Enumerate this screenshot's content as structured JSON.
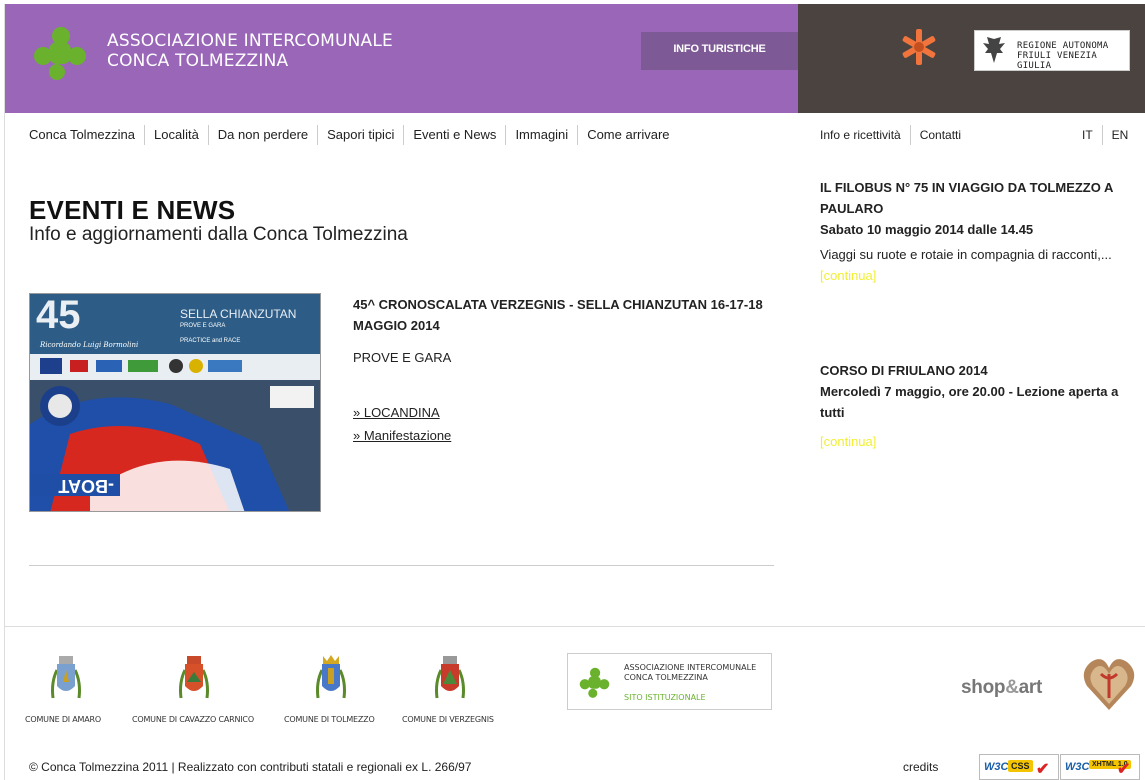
{
  "header": {
    "logo_line1": "ASSOCIAZIONE INTERCOMUNALE",
    "logo_line2": "CONCA TOLMEZZINA",
    "info_button": "INFO TURISTICHE",
    "region_line1": "REGIONE AUTONOMA",
    "region_line2": "FRIULI VENEZIA GIULIA",
    "colors": {
      "purple": "#9966b8",
      "dark": "#4a4340",
      "green": "#6ab22d",
      "orange": "#f0743c"
    }
  },
  "nav": {
    "items": [
      "Conca Tolmezzina",
      "Località",
      "Da non perdere",
      "Sapori tipici",
      "Eventi e News",
      "Immagini",
      "Come arrivare"
    ],
    "right": [
      "Info e ricettività",
      "Contatti"
    ],
    "languages": [
      "IT",
      "EN"
    ]
  },
  "main": {
    "title": "EVENTI E NEWS",
    "subtitle": "Info e aggiornamenti dalla Conca Tolmezzina",
    "event": {
      "title": "45^ CRONOSCALATA VERZEGNIS - SELLA CHIANZUTAN 16-17-18 MAGGIO 2014",
      "desc": "PROVE E GARA",
      "links": [
        "» LOCANDINA",
        "» Manifestazione"
      ],
      "image_text": {
        "big_number": "45",
        "heading": "SELLA CHIANZUTAN",
        "row1": "PROVE E GARA",
        "row2": "PRACTICE and RACE",
        "subtitle": "Ricordando Luigi Bormolini",
        "banner": "-BOAT"
      }
    }
  },
  "sidebar": {
    "news": [
      {
        "title": "IL FILOBUS N° 75 IN VIAGGIO DA TOLMEZZO A PAULARO",
        "date": "Sabato 10 maggio 2014 dalle 14.45",
        "text": "Viaggi su ruote e rotaie in compagnia di racconti,...",
        "more": "[continua]"
      },
      {
        "title": "CORSO DI FRIULANO 2014",
        "date": "Mercoledì 7 maggio, ore 20.00 - Lezione aperta a tutti",
        "text": "",
        "more": "[continua]"
      }
    ]
  },
  "footer": {
    "comuni": [
      "COMUNE DI AMARO",
      "COMUNE DI CAVAZZO CARNICO",
      "COMUNE DI TOLMEZZO",
      "COMUNE DI VERZEGNIS"
    ],
    "assoc_line1": "ASSOCIAZIONE INTERCOMUNALE",
    "assoc_line2": "CONCA TOLMEZZINA",
    "assoc_sub": "SITO ISTITUZIONALE",
    "shop_pre": "shop",
    "shop_amp": "&",
    "shop_post": "art",
    "copyright": "© Conca Tolmezzina 2011 | Realizzato con contributi statali e regionali ex L. 266/97",
    "credits": "credits",
    "w3c_css": "CSS",
    "w3c_xhtml": "XHTML 1.0",
    "w3c_brand": "W3C"
  }
}
